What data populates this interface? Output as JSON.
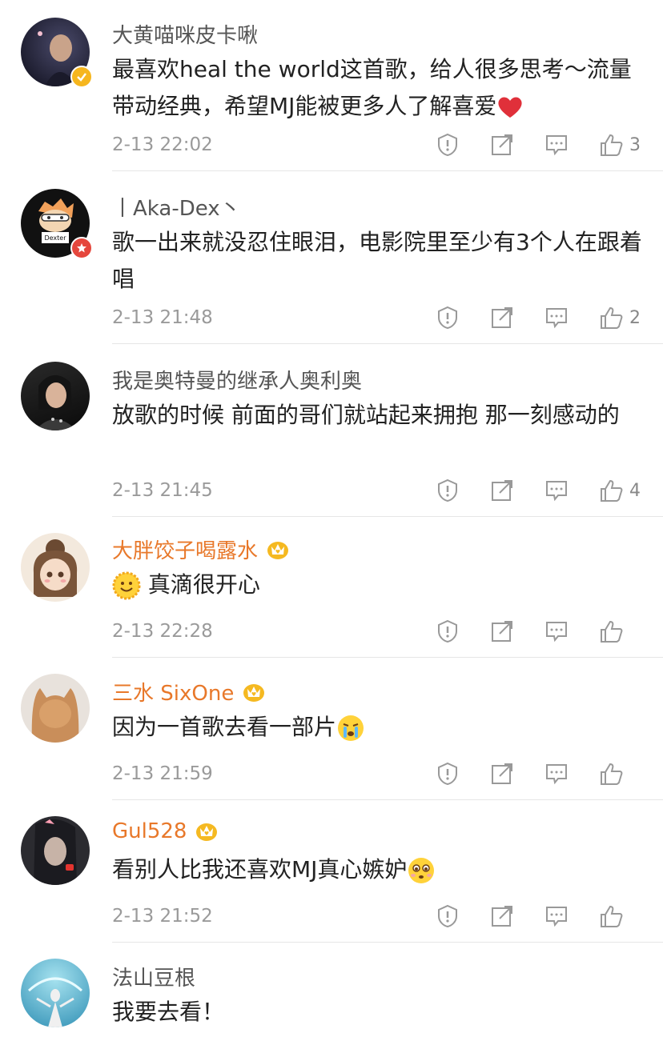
{
  "comments": [
    {
      "name": "大黄喵咪皮卡啾",
      "text_parts": [
        "最喜欢heal the world这首歌，给人很多思考～流量带动经典，希望MJ能被更多人了解喜爱"
      ],
      "emoji": "heart",
      "time": "2-13 22:02",
      "likes": "3",
      "badge": "verified-yellow"
    },
    {
      "name": "丨Aka-Dex丶",
      "text_parts": [
        "歌一出来就没忍住眼泪，电影院里至少有3个人在跟着唱"
      ],
      "time": "2-13 21:48",
      "likes": "2",
      "badge": "star-red",
      "avatar_text": "Dexter"
    },
    {
      "name": "我是奥特曼的继承人奥利奥",
      "text_parts": [
        "放歌的时候 前面的哥们就站起来拥抱 那一刻感动的"
      ],
      "time": "2-13 21:45",
      "likes": "4"
    },
    {
      "name": "大胖饺子喝露水",
      "text_parts": [
        "真滴很开心"
      ],
      "emoji_before": "smile",
      "time": "2-13 22:28",
      "likes": "",
      "vip": true
    },
    {
      "name": "三水 SixOne",
      "text_parts": [
        "因为一首歌去看一部片"
      ],
      "emoji": "cry",
      "time": "2-13 21:59",
      "likes": "",
      "vip": true
    },
    {
      "name": "Gul528",
      "text_parts": [
        "看别人比我还喜欢MJ真心嫉妒"
      ],
      "emoji": "pout",
      "time": "2-13 21:52",
      "likes": "",
      "vip": true
    },
    {
      "name": "法山豆根",
      "text_parts": [
        "我要去看！"
      ],
      "time": "",
      "likes": ""
    }
  ],
  "colors": {
    "vip_name": "#e8782a",
    "normal_name": "#555555",
    "heart": "#e0303a"
  },
  "icons": [
    "report-icon",
    "share-icon",
    "comment-icon",
    "like-icon",
    "crown-icon",
    "verified-icon"
  ]
}
